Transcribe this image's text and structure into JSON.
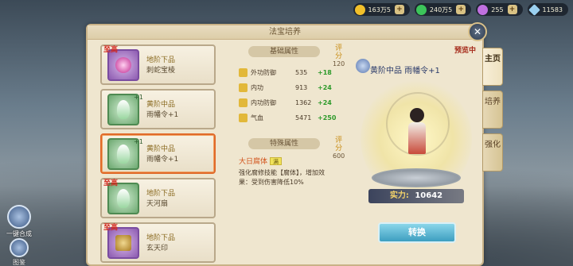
{
  "currency": [
    {
      "icon": "gold-coin-icon",
      "value": "163万5",
      "color": "#f2c02a"
    },
    {
      "icon": "jade-gem-icon",
      "value": "240万5",
      "color": "#3cc45a"
    },
    {
      "icon": "purple-orb-icon",
      "value": "255",
      "color": "#c070e0"
    },
    {
      "icon": "diamond-icon",
      "value": "11583",
      "color": "#9ad0f0"
    }
  ],
  "panel": {
    "title": "法宝培养",
    "close_label": "✕"
  },
  "items": [
    {
      "tag": "至高",
      "grade": "地阶下品",
      "name": "刺蛇宝棱",
      "thumb": "purple",
      "plus": ""
    },
    {
      "tag": "",
      "grade": "黄阶中品",
      "name": "雨幡令+1",
      "thumb": "green",
      "plus": "+1"
    },
    {
      "tag": "",
      "grade": "黄阶中品",
      "name": "雨幡令+1",
      "thumb": "green",
      "plus": "+1"
    },
    {
      "tag": "至高",
      "grade": "地阶下品",
      "name": "天河扇",
      "thumb": "green",
      "plus": ""
    },
    {
      "tag": "至高",
      "grade": "地阶下品",
      "name": "玄天印",
      "thumb": "purple",
      "plus": ""
    }
  ],
  "base": {
    "label": "基础属性",
    "score_label": "评分",
    "score": "120",
    "attrs": [
      {
        "name": "外功防御",
        "value": "535",
        "delta": "+18"
      },
      {
        "name": "内功",
        "value": "913",
        "delta": "+24"
      },
      {
        "name": "内功防御",
        "value": "1362",
        "delta": "+24"
      },
      {
        "name": "气血",
        "value": "5471",
        "delta": "+250"
      }
    ]
  },
  "special": {
    "label": "特殊属性",
    "score_label": "评分",
    "score": "600",
    "skill": "大日腐体",
    "level": "满",
    "desc": "强化腐修技能【腐体】，增加效果：受到伤害降低10%"
  },
  "preview": {
    "tag": "预览中",
    "title": "黄阶中品 雨幡令+1",
    "power_label": "实力:",
    "power_value": "10642",
    "swap_label": "转换"
  },
  "tabs": [
    "主页",
    "培养",
    "强化"
  ],
  "left_buttons": [
    "一键合成",
    "图鉴"
  ]
}
